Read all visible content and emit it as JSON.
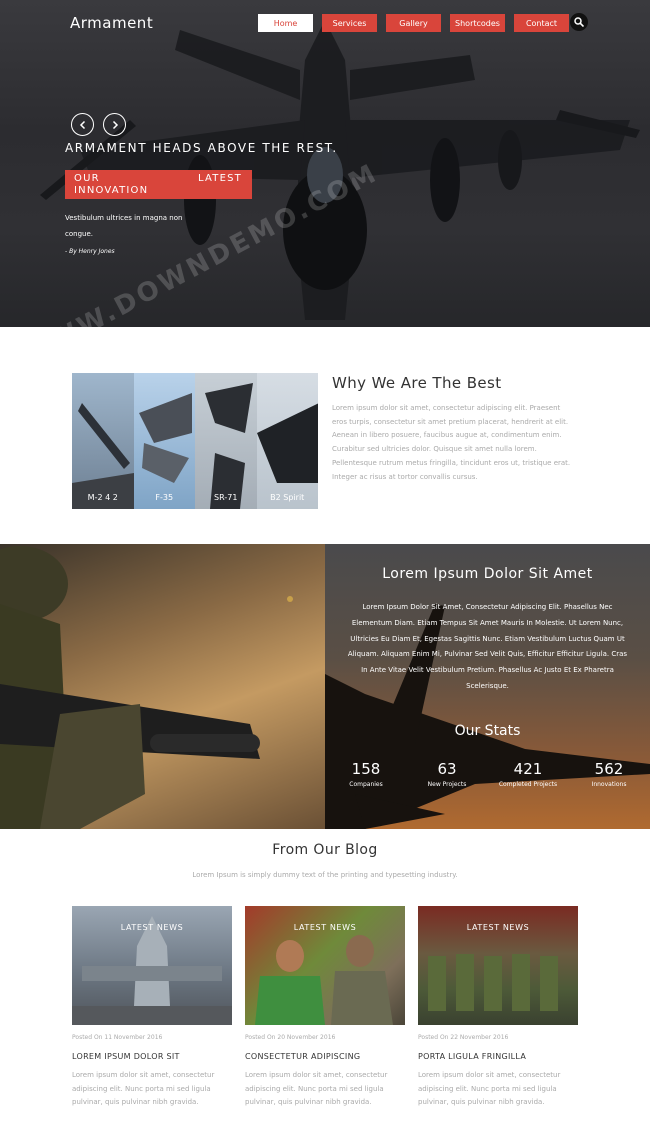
{
  "brand": "Armament",
  "nav": [
    {
      "label": "Home"
    },
    {
      "label": "Services"
    },
    {
      "label": "Gallery"
    },
    {
      "label": "Shortcodes"
    },
    {
      "label": "Contact"
    }
  ],
  "hero": {
    "headline": "ARMAMENT HEADS ABOVE THE REST.",
    "badge_left": "OUR",
    "badge_right": "LATEST",
    "badge_line2": "INNOVATION",
    "text": "Vestibulum ultrices in magna non congue.",
    "author": "- By Henry Jones"
  },
  "why": {
    "title": "Why We Are The Best",
    "body": "Lorem ipsum dolor sit amet, consectetur adipiscing elit. Praesent eros turpis, consectetur sit amet pretium placerat, hendrerit at elit. Aenean in libero posuere, faucibus augue at, condimentum enim. Curabitur sed ultricies dolor. Quisque sit amet nulla lorem. Pellentesque rutrum metus fringilla, tincidunt eros ut, tristique erat. Integer ac risus at tortor convallis cursus.",
    "panels": [
      {
        "label": "M-2 4 2"
      },
      {
        "label": "F-35"
      },
      {
        "label": "SR-71"
      },
      {
        "label": "B2 Spirit"
      }
    ]
  },
  "mid": {
    "title": "Lorem Ipsum Dolor Sit Amet",
    "body": "Lorem Ipsum Dolor Sit Amet, Consectetur Adipiscing Elit. Phasellus Nec Elementum Diam. Etiam Tempus Sit Amet Mauris In Molestie. Ut Lorem Nunc, Ultricies Eu Diam Et, Egestas Sagittis Nunc. Etiam Vestibulum Luctus Quam Ut Aliquam. Aliquam Enim Mi, Pulvinar Sed Velit Quis, Efficitur Efficitur Ligula. Cras In Ante Vitae Velit Vestibulum Pretium. Phasellus Ac Justo Et Ex Pharetra Scelerisque.",
    "stats_title": "Our Stats",
    "stats": [
      {
        "value": "158",
        "label": "Companies"
      },
      {
        "value": "63",
        "label": "New Projects"
      },
      {
        "value": "421",
        "label": "Completed Projects"
      },
      {
        "value": "562",
        "label": "Innovations"
      }
    ]
  },
  "blog": {
    "title": "From Our Blog",
    "subtitle": "Lorem Ipsum is simply dummy text of the printing and typesetting industry.",
    "posts": [
      {
        "tag": "LATEST NEWS",
        "date": "Posted On 11 November 2016",
        "title": "LOREM IPSUM DOLOR SIT",
        "excerpt": "Lorem ipsum dolor sit amet, consectetur adipiscing elit. Nunc porta mi sed ligula pulvinar, quis pulvinar nibh gravida."
      },
      {
        "tag": "LATEST NEWS",
        "date": "Posted On 20 November 2016",
        "title": "CONSECTETUR ADIPISCING",
        "excerpt": "Lorem ipsum dolor sit amet, consectetur adipiscing elit. Nunc porta mi sed ligula pulvinar, quis pulvinar nibh gravida."
      },
      {
        "tag": "LATEST NEWS",
        "date": "Posted On 22 November 2016",
        "title": "PORTA LIGULA FRINGILLA",
        "excerpt": "Lorem ipsum dolor sit amet, consectetur adipiscing elit. Nunc porta mi sed ligula pulvinar, quis pulvinar nibh gravida."
      }
    ]
  },
  "watermark": "WWW.DOWNDEMO.COM"
}
